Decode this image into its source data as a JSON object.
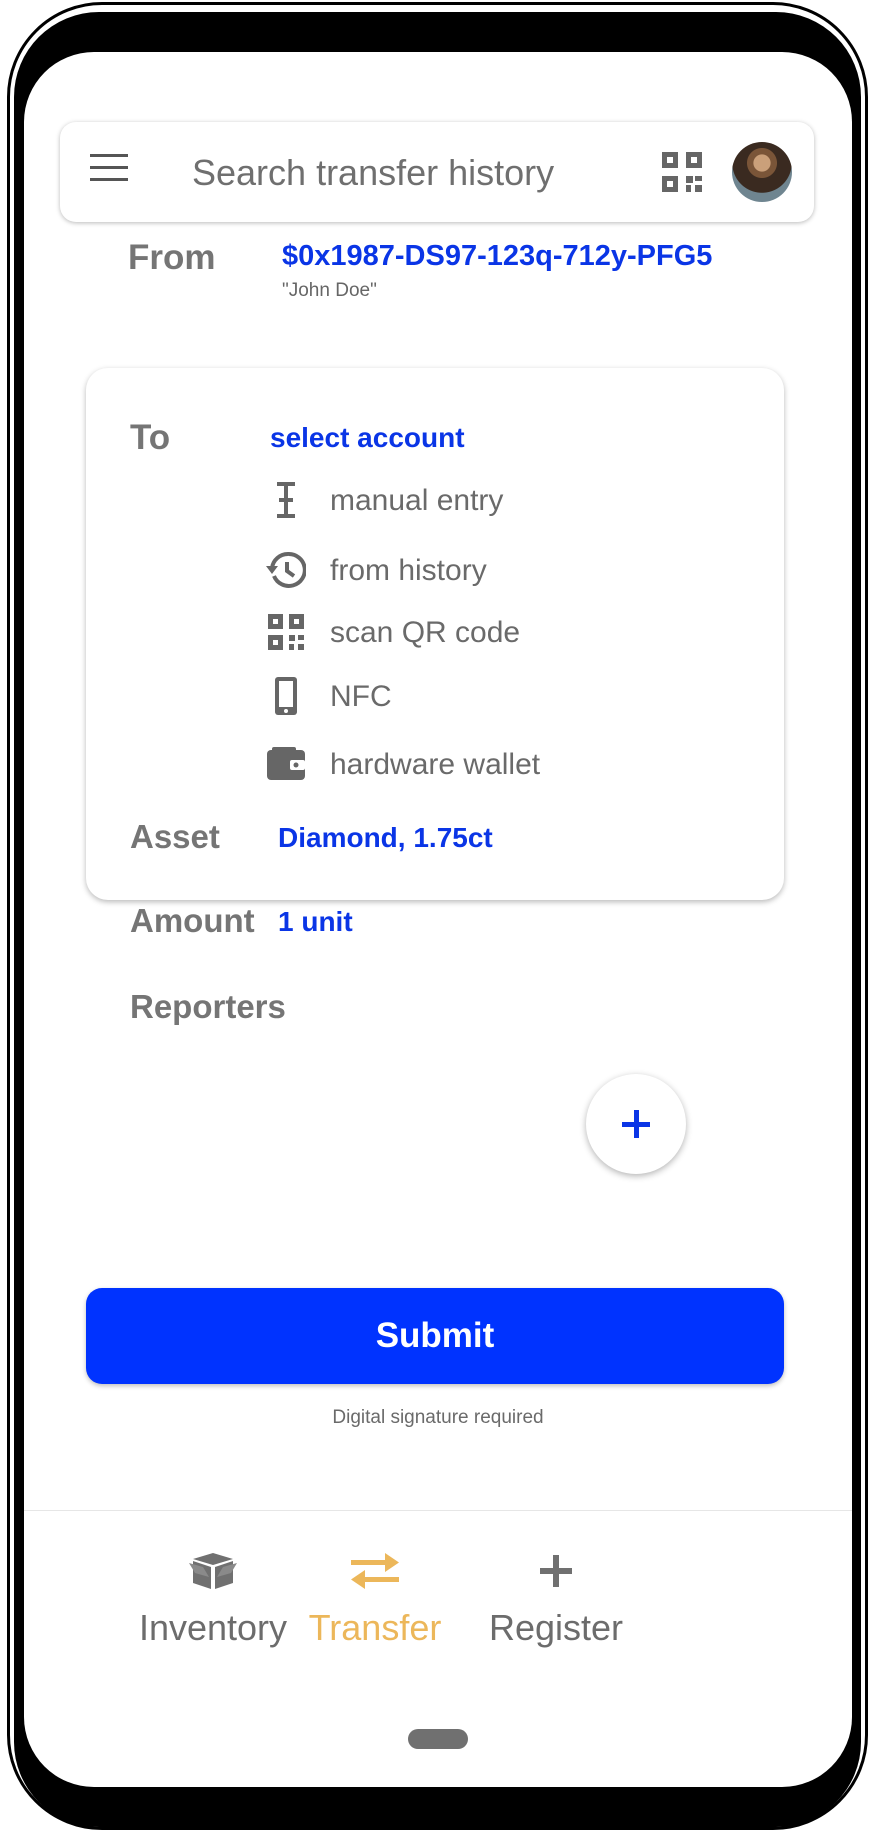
{
  "search": {
    "placeholder": "Search transfer history"
  },
  "from": {
    "label": "From",
    "account": "$0x1987-DS97-123q-712y-PFG5",
    "name": "\"John Doe\""
  },
  "to": {
    "label": "To",
    "select_label": "select account",
    "options": [
      {
        "label": "manual entry",
        "icon": "text-cursor-icon"
      },
      {
        "label": "from history",
        "icon": "history-icon"
      },
      {
        "label": "scan QR code",
        "icon": "qr-code-icon"
      },
      {
        "label": "NFC",
        "icon": "phone-icon"
      },
      {
        "label": "hardware wallet",
        "icon": "wallet-icon"
      }
    ]
  },
  "asset": {
    "label": "Asset",
    "value": "Diamond, 1.75ct"
  },
  "amount": {
    "label": "Amount",
    "value": "1 unit"
  },
  "reporters": {
    "label": "Reporters"
  },
  "submit": {
    "label": "Submit",
    "note": "Digital signature required"
  },
  "nav": {
    "items": [
      {
        "label": "Inventory",
        "icon": "box-icon"
      },
      {
        "label": "Transfer",
        "icon": "swap-arrows-icon",
        "active": true
      },
      {
        "label": "Register",
        "icon": "plus-icon"
      }
    ]
  },
  "colors": {
    "accent": "#0033FF",
    "link": "#0A35E6",
    "active_nav": "#ECB75A",
    "label": "#757575"
  }
}
